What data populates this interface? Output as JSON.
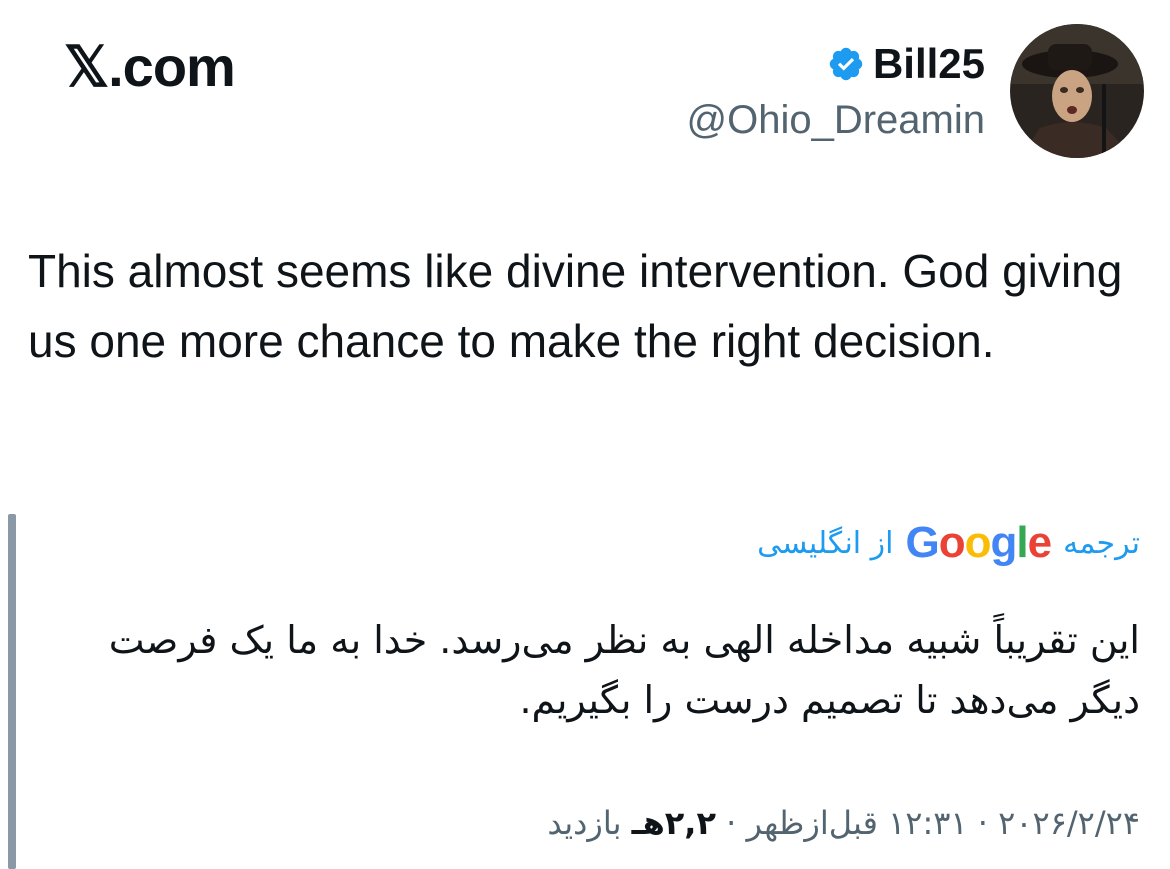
{
  "header": {
    "site_label": "𝕏.com"
  },
  "author": {
    "display_name": "Bill25",
    "handle": "@Ohio_Dreamin",
    "verified_color": "#1d9bf0"
  },
  "tweet": {
    "text": "This almost seems like divine intervention. God giving us one more chance to make the right decision."
  },
  "translation": {
    "prefix_label": "ترجمه",
    "provider": "Google",
    "suffix_label": "از انگلیسی",
    "link_color": "#1d9bf0",
    "text": "این تقریباً شبیه مداخله الهی به نظر می‌رسد. خدا به ما یک فرصت دیگر می‌دهد تا تصمیم درست را بگیریم."
  },
  "meta": {
    "date": "۲۰۲۶/۲/۲۴",
    "separator": "·",
    "time": "۱۲:۳۱ قبل‌ازظهر",
    "views_count": "۲,۲هـ",
    "views_label": "بازدید"
  }
}
